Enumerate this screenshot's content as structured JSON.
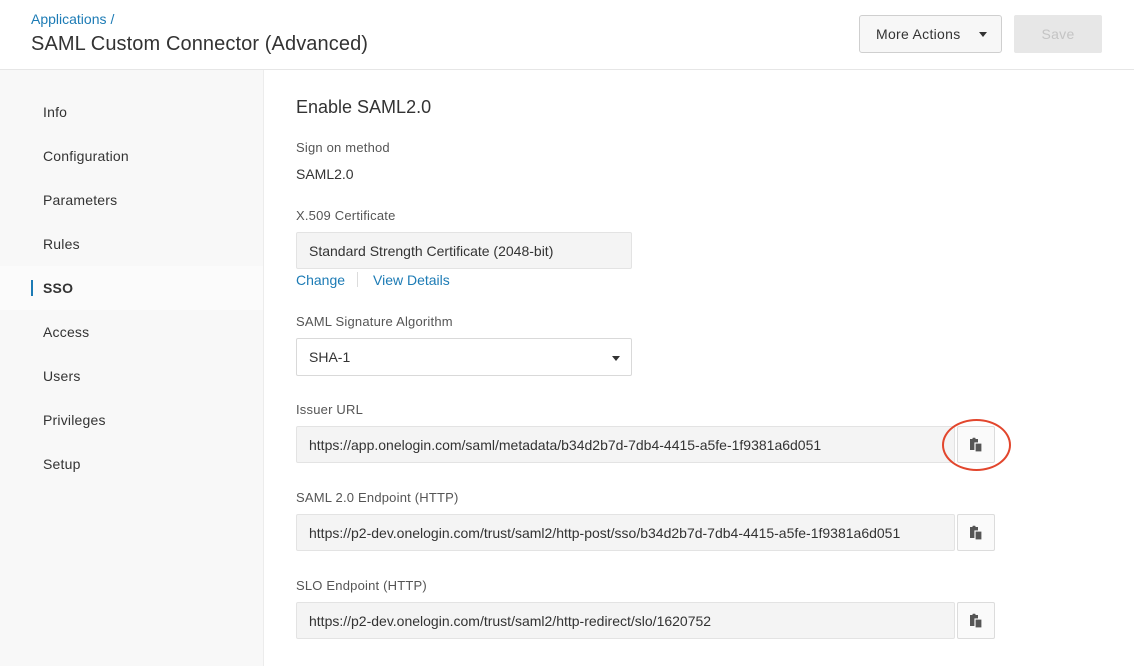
{
  "header": {
    "breadcrumb": "Applications",
    "breadcrumb_sep": "/",
    "title": "SAML Custom Connector (Advanced)",
    "more_actions_label": "More Actions",
    "save_label": "Save"
  },
  "sidebar": {
    "items": [
      {
        "label": "Info"
      },
      {
        "label": "Configuration"
      },
      {
        "label": "Parameters"
      },
      {
        "label": "Rules"
      },
      {
        "label": "SSO"
      },
      {
        "label": "Access"
      },
      {
        "label": "Users"
      },
      {
        "label": "Privileges"
      },
      {
        "label": "Setup"
      }
    ],
    "active": "SSO"
  },
  "main": {
    "section_title": "Enable SAML2.0",
    "sign_on": {
      "label": "Sign on method",
      "value": "SAML2.0"
    },
    "certificate": {
      "label": "X.509 Certificate",
      "value": "Standard Strength Certificate (2048-bit)",
      "change_link": "Change",
      "view_details_link": "View Details"
    },
    "signature_algorithm": {
      "label": "SAML Signature Algorithm",
      "value": "SHA-1"
    },
    "issuer_url": {
      "label": "Issuer URL",
      "value": "https://app.onelogin.com/saml/metadata/b34d2b7d-7db4-4415-a5fe-1f9381a6d051"
    },
    "saml_endpoint": {
      "label": "SAML 2.0 Endpoint (HTTP)",
      "value": "https://p2-dev.onelogin.com/trust/saml2/http-post/sso/b34d2b7d-7db4-4415-a5fe-1f9381a6d051"
    },
    "slo_endpoint": {
      "label": "SLO Endpoint (HTTP)",
      "value": "https://p2-dev.onelogin.com/trust/saml2/http-redirect/slo/1620752"
    }
  },
  "icons": {
    "copy": "copy-icon",
    "dropdown": "chevron-down-icon"
  },
  "colors": {
    "accent": "#1c7bb5",
    "highlight": "#e2462d"
  }
}
